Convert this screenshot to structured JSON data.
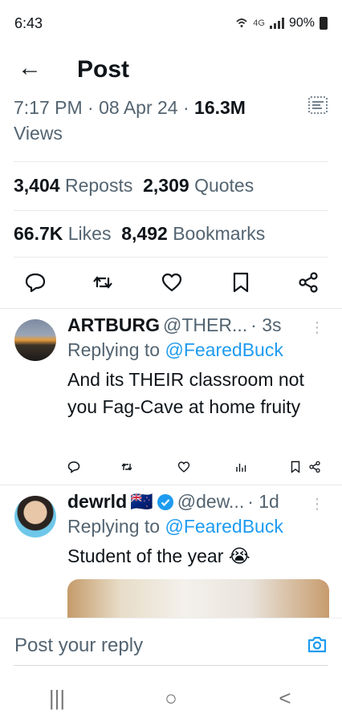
{
  "status_bar": {
    "time": "6:43",
    "network": "4G",
    "battery": "90%"
  },
  "header": {
    "title": "Post"
  },
  "post_meta": {
    "time": "7:17 PM",
    "date": "08 Apr 24",
    "views_count": "16.3M",
    "views_label": "Views",
    "sep": " · "
  },
  "stats": {
    "reposts_count": "3,404",
    "reposts_label": "Reposts",
    "quotes_count": "2,309",
    "quotes_label": "Quotes",
    "likes_count": "66.7K",
    "likes_label": "Likes",
    "bookmarks_count": "8,492",
    "bookmarks_label": "Bookmarks"
  },
  "replies": [
    {
      "name": "ARTBURG",
      "handle": "@THER...",
      "time": "· 3s",
      "replying_prefix": "Replying to",
      "replying_to": "@FearedBuck",
      "text": "And its THEIR classroom not you Fag-Cave at home fruity"
    },
    {
      "name": "dewrld",
      "flag": "🇳🇿",
      "handle": "@dew...",
      "time": "· 1d",
      "replying_prefix": "Replying to",
      "replying_to": "@FearedBuck",
      "text": "Student of the year 😭"
    }
  ],
  "reply_composer": {
    "placeholder": "Post your reply"
  },
  "nav": {
    "recents": "|||",
    "home": "○",
    "back": "<"
  },
  "colors": {
    "accent": "#1d9bf0",
    "text": "#0f1419",
    "muted": "#536471"
  }
}
